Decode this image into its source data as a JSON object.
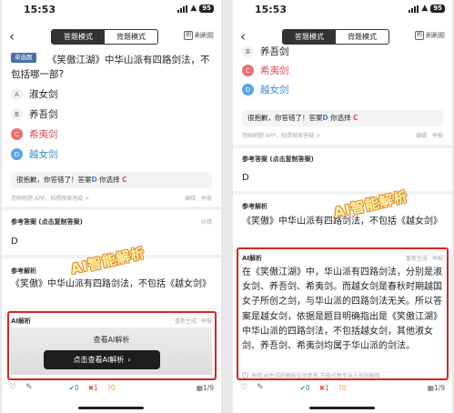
{
  "status": {
    "time": "15:53",
    "battery": "95"
  },
  "header": {
    "mode_answer": "答题模式",
    "mode_memorize": "背题模式",
    "logo_text": "刷刷题"
  },
  "question": {
    "type_badge": "单选题",
    "text": "《笑傲江湖》中华山派有四路剑法，不包括哪一部?",
    "options": [
      {
        "letter": "A",
        "text": "淑女剑"
      },
      {
        "letter": "B",
        "text": "养吾剑"
      },
      {
        "letter": "C",
        "text": "希夷剑"
      },
      {
        "letter": "D",
        "text": "越女剑"
      }
    ]
  },
  "result": {
    "prefix": "很抱歉，你答错了！答案",
    "correct": "D",
    "mid": " 你选择",
    "chosen": "C"
  },
  "hint": {
    "text": "用刷刷题 APP，拍照搜索答疑 >",
    "edit": "编辑",
    "report": "举报"
  },
  "reference_answer": {
    "title": "参考答案 (点击复制答案)",
    "copy": "纠错",
    "value": "D"
  },
  "reference_analysis": {
    "title": "参考解析",
    "text": "《笑傲》中华山派有四路剑法，不包括《越女剑》"
  },
  "ai_analysis": {
    "title": "AI解析",
    "regenerate": "重新生成",
    "report": "举报",
    "view_label": "查看AI解析",
    "button_label": "点击查看AI解析",
    "body": "在《笑傲江湖》中，华山派有四路剑法，分别是淑女剑、养吾剑、希夷剑。而越女剑是春秋时期越国女子所创之剑，与华山派的四路剑法无关。所以答案是越女剑，依据是题目明确指出是《笑傲江湖》中华山派的四路剑法，不包括越女剑，其他淑女剑、养吾剑、希夷剑均属于华山派的剑法。",
    "disclaimer": "声明:AI生成的解析仅供参考,不能代替专业人员的解释"
  },
  "overlay_label": "AI智能解析",
  "bottom": {
    "correct_count": "0",
    "wrong_count": "1",
    "unknown_count": "0",
    "page": "1/9"
  },
  "colors": {
    "wrong": "#ef6e6e",
    "right": "#58a6e8",
    "highlight_border": "#e02020",
    "accent": "#4a6fa5"
  }
}
